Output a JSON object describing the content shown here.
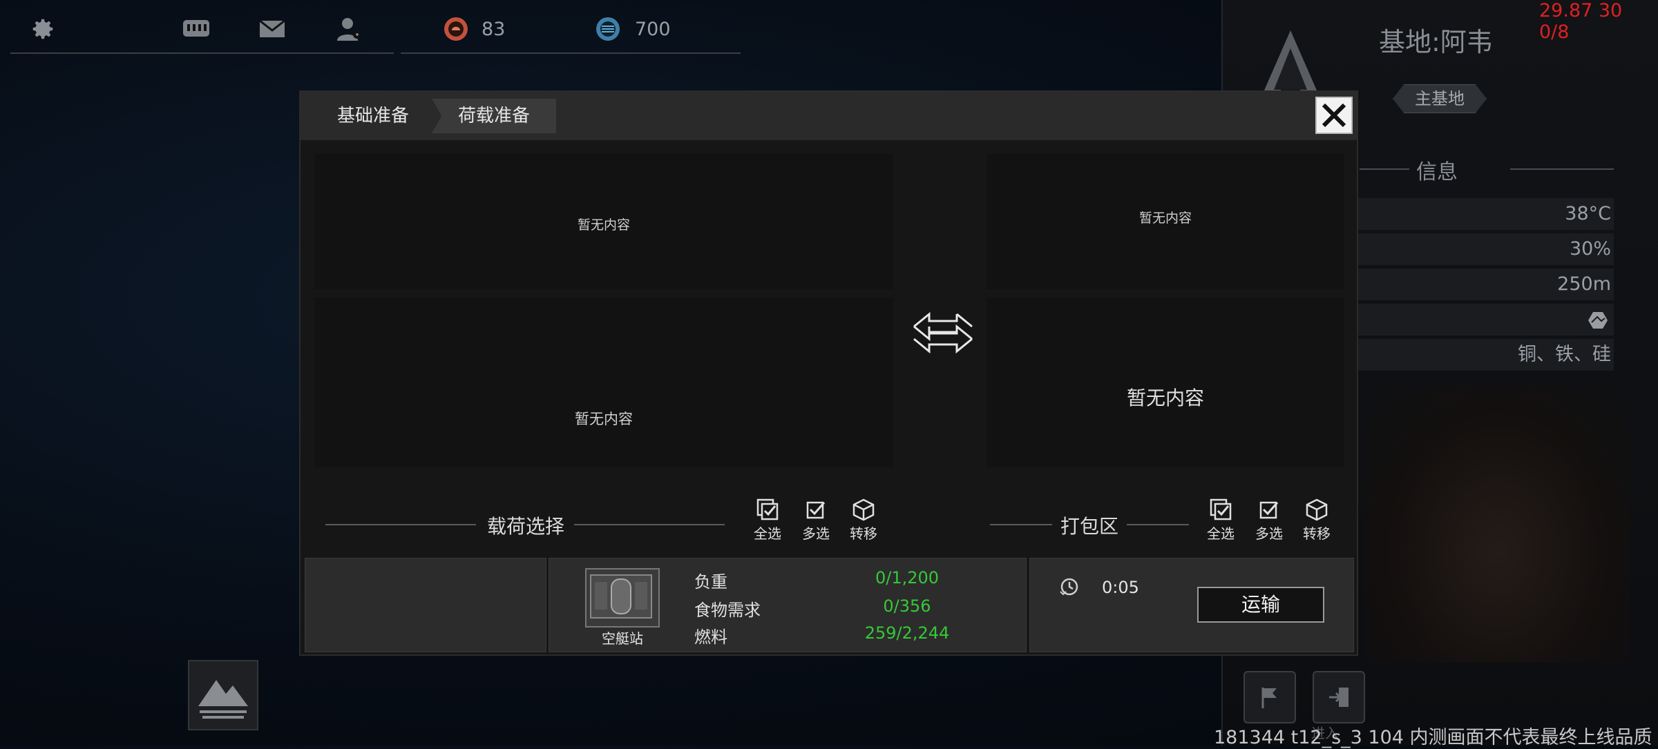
{
  "hud": {
    "debug_text": "29.87 30 0/8",
    "resource_1": "83",
    "resource_2": "700",
    "watermark": "181344 t12_s_3 104  内测画面不代表最终上线品质",
    "overlap_label": "进入"
  },
  "base_panel": {
    "title": "基地:阿韦",
    "badge": "主基地",
    "section_title": "信息",
    "rows": [
      "38°C",
      "30%",
      "250m",
      "",
      "铜、铁、硅"
    ]
  },
  "modal": {
    "tabs": [
      "基础准备",
      "荷载准备"
    ],
    "left_top_empty": "暂无内容",
    "left_bottom_empty": "暂无内容",
    "right_top_empty": "暂无内容",
    "right_bottom_empty": "暂无内容",
    "left_section_title": "载荷选择",
    "right_section_title": "打包区",
    "tools": [
      "全选",
      "多选",
      "转移"
    ],
    "vehicle_name": "空艇站",
    "stats": [
      {
        "label": "负重",
        "value": "0/1,200"
      },
      {
        "label": "食物需求",
        "value": "0/356"
      },
      {
        "label": "燃料",
        "value": "259/2,244"
      }
    ],
    "timer": "0:05",
    "transport_label": "运输"
  },
  "colors": {
    "accent_green": "#37c837",
    "debug_red": "#e02020",
    "modal_bg": "#161616"
  }
}
